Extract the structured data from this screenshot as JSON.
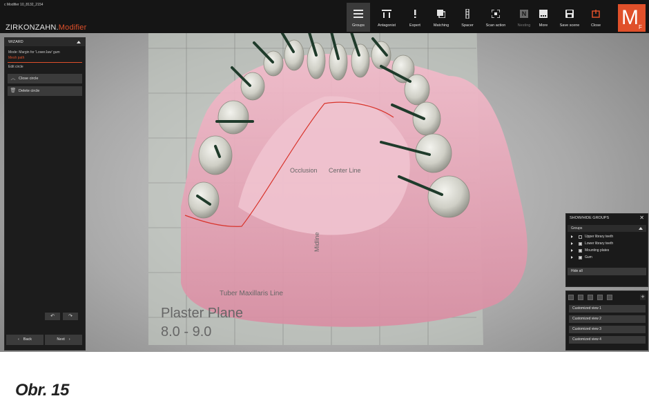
{
  "window": {
    "title": "c Modifier 10_8132_2154"
  },
  "brand": {
    "name": "ZIRKONZAHN.",
    "accent": "Modifier",
    "logo": "M",
    "logo_sub": "F"
  },
  "toolbar": {
    "groups": "Groups",
    "antagonist": "Antagonist",
    "expert": "Expert",
    "matching": "Matching",
    "spacer": "Spacer",
    "scan_action": "Scan action",
    "nesting": "Nesting",
    "nesting_glyph": "N",
    "more": "More",
    "save_scene": "Save scene",
    "close": "Close"
  },
  "wizard": {
    "title": "WIZARD",
    "mode_line": "Mode: Margin for 'LowerJaw' gum",
    "mesh_path": "Mesh path",
    "edit_circle": "Edit circle",
    "close_circle": "Close circle",
    "delete_circle": "Delete circle",
    "back": "Back",
    "next": "Next"
  },
  "scene_labels": {
    "occlusion": "Occlusion",
    "center_line": "Center Line",
    "midline": "Midline",
    "tuber": "Tuber Maxillaris Line",
    "plaster_plane": "Plaster Plane",
    "plaster_range": "8.0 - 9.0"
  },
  "groups_panel": {
    "title": "SHOW/HIDE GROUPS",
    "close_glyph": "✕",
    "subheader": "Groups",
    "items": [
      {
        "label": "Upper library teeth",
        "checked": false
      },
      {
        "label": "Lower library teeth",
        "checked": true
      },
      {
        "label": "Mounting plates",
        "checked": true
      },
      {
        "label": "Gum",
        "checked": true
      }
    ],
    "hide_all": "Hide all"
  },
  "views_panel": {
    "add_glyph": "+",
    "views": [
      "Customized view 1",
      "Customized view 2",
      "Customized view 3",
      "Customized view 4"
    ]
  },
  "colors": {
    "accent": "#e0502a",
    "gum": "#e9a7b6",
    "tooth": "#d9d9d2",
    "pin": "#1f3b2b"
  },
  "caption": "Obr. 15"
}
